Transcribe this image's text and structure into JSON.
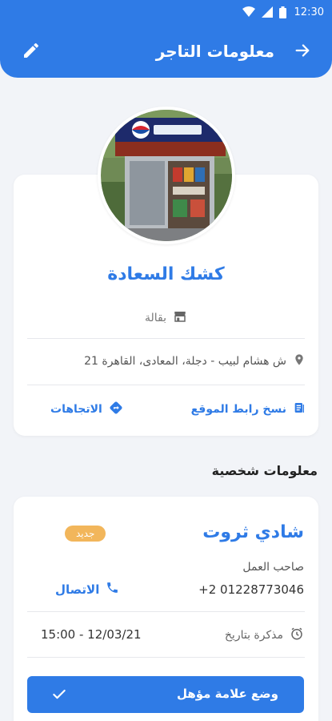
{
  "status_bar": {
    "time": "12:30"
  },
  "header": {
    "title": "معلومات التاجر"
  },
  "store": {
    "name": "كشك السعادة",
    "category": "بقالة",
    "address": "ش هشام لبيب - دجلة، المعادى، القاهرة 21",
    "copy_location_label": "نسخ رابط الموقع",
    "directions_label": "الاتجاهات"
  },
  "personal": {
    "section_title": "معلومات شخصية",
    "name": "شادي ثروت",
    "badge": "جديد",
    "role": "صاحب العمل",
    "phone": "+2 01228773046",
    "call_label": "الاتصال",
    "reminder_label": "مذكرة بتاريخ",
    "reminder_value": "15:00 - 12/03/21",
    "qualify_button": "وضع علامة مؤهل"
  },
  "colors": {
    "primary": "#2f7be6",
    "badge": "#f2b65b",
    "background": "#f2f4f8"
  },
  "icons": [
    "wifi-icon",
    "signal-icon",
    "battery-icon",
    "edit-icon",
    "back-arrow-icon",
    "store-icon",
    "location-pin-icon",
    "copy-icon",
    "directions-icon",
    "phone-icon",
    "clock-icon",
    "check-icon"
  ]
}
